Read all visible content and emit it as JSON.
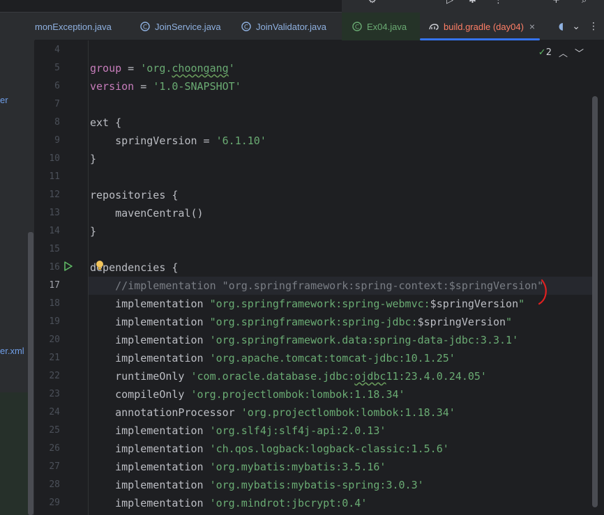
{
  "tabs": [
    {
      "label": "monException.java",
      "icon": "java-class-icon"
    },
    {
      "label": "JoinService.java",
      "icon": "java-class-icon"
    },
    {
      "label": "JoinValidator.java",
      "icon": "java-class-icon"
    },
    {
      "label": "Ex04.java",
      "icon": "java-class-icon"
    },
    {
      "label": "build.gradle (day04)",
      "icon": "gradle-icon",
      "active": true,
      "close": "×"
    }
  ],
  "sidebar": {
    "fragments": [
      "er",
      "er.xml"
    ]
  },
  "inspection": {
    "count": "2"
  },
  "current_line": "17",
  "lines": [
    {
      "num": "4",
      "text": ""
    },
    {
      "num": "5",
      "text": "group = 'org.choongang'"
    },
    {
      "num": "6",
      "text": "version = '1.0-SNAPSHOT'"
    },
    {
      "num": "7",
      "text": ""
    },
    {
      "num": "8",
      "text": "ext {"
    },
    {
      "num": "9",
      "text": "    springVersion = '6.1.10'"
    },
    {
      "num": "10",
      "text": "}"
    },
    {
      "num": "11",
      "text": ""
    },
    {
      "num": "12",
      "text": "repositories {"
    },
    {
      "num": "13",
      "text": "    mavenCentral()"
    },
    {
      "num": "14",
      "text": "}"
    },
    {
      "num": "15",
      "text": ""
    },
    {
      "num": "16",
      "text": "dependencies {"
    },
    {
      "num": "17",
      "text": "    //implementation \"org.springframework:spring-context:$springVersion\""
    },
    {
      "num": "18",
      "text": "    implementation \"org.springframework:spring-webmvc:$springVersion\""
    },
    {
      "num": "19",
      "text": "    implementation \"org.springframework:spring-jdbc:$springVersion\""
    },
    {
      "num": "20",
      "text": "    implementation 'org.springframework.data:spring-data-jdbc:3.3.1'"
    },
    {
      "num": "21",
      "text": "    implementation 'org.apache.tomcat:tomcat-jdbc:10.1.25'"
    },
    {
      "num": "22",
      "text": "    runtimeOnly 'com.oracle.database.jdbc:ojdbc11:23.4.0.24.05'"
    },
    {
      "num": "23",
      "text": "    compileOnly 'org.projectlombok:lombok:1.18.34'"
    },
    {
      "num": "24",
      "text": "    annotationProcessor 'org.projectlombok:lombok:1.18.34'"
    },
    {
      "num": "25",
      "text": "    implementation 'org.slf4j:slf4j-api:2.0.13'"
    },
    {
      "num": "26",
      "text": "    implementation 'ch.qos.logback:logback-classic:1.5.6'"
    },
    {
      "num": "27",
      "text": "    implementation 'org.mybatis:mybatis:3.5.16'"
    },
    {
      "num": "28",
      "text": "    implementation 'org.mybatis:mybatis-spring:3.0.3'"
    },
    {
      "num": "29",
      "text": "    implementation 'org.mindrot:jbcrypt:0.4'"
    }
  ],
  "colors": {
    "keyword": "#c77dbb",
    "string": "#6aab73",
    "comment": "#7a7e85",
    "active_tab_text": "#ff7f66",
    "accent": "#3574f0"
  }
}
